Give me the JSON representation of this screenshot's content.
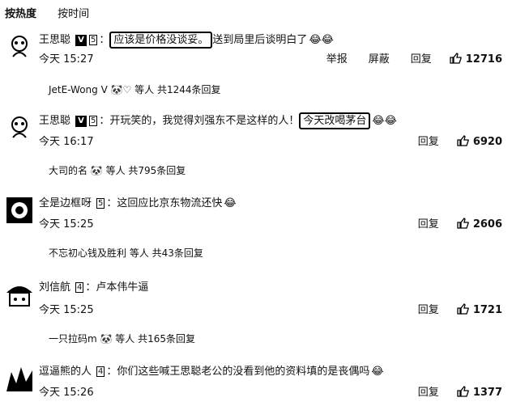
{
  "sort_tabs": {
    "hot": "按热度",
    "time": "按时间"
  },
  "comments": [
    {
      "name": "王思聪",
      "level": "5",
      "prefix": "：",
      "boxed": "应该是价格没谈妥。",
      "after": "送到局里后谈明白了",
      "time": "今天 15:27",
      "report": "举报",
      "block": "屏蔽",
      "reply": "回复",
      "likes": "12716",
      "replies": "JetE-Wong V 🐼♡ 等人 共1244条回复"
    },
    {
      "name": "王思聪",
      "level": "5",
      "before": "：开玩笑的，我觉得刘强东不是这样的人！",
      "boxed": "今天改喝茅台",
      "time": "今天 16:17",
      "reply": "回复",
      "likes": "6920",
      "replies": "大司的名 🐼 等人 共795条回复"
    },
    {
      "name": "全是边框呀",
      "level": "5",
      "text": "：这回应比京东物流还快",
      "time": "今天 15:25",
      "reply": "回复",
      "likes": "2606",
      "replies": "不忘初心钱及胜利 等人 共43条回复"
    },
    {
      "name": "刘信航",
      "level": "4",
      "text": "：卢本伟牛逼",
      "time": "今天 15:25",
      "reply": "回复",
      "likes": "1721",
      "replies": "一只拉码m 🐼 等人 共165条回复"
    },
    {
      "name": "逗逼熊的人",
      "level": "4",
      "text": "：你们这些喊王思聪老公的没看到他的资料填的是丧偶吗",
      "time": "今天 15:26",
      "reply": "回复",
      "likes": "1377"
    }
  ]
}
